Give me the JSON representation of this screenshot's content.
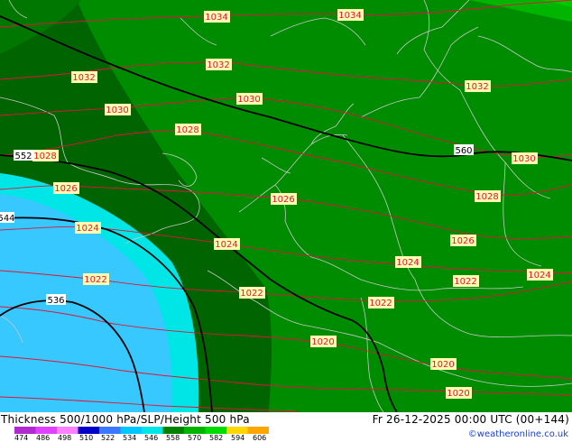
{
  "title": "Thickness 500/1000 hPa/SLP/Height 500 hPa",
  "datetime": "Fr 26-12-2025 00:00 UTC (00+144)",
  "credit": "©weatheronline.co.uk",
  "colorbar": {
    "ticks": [
      "474",
      "486",
      "498",
      "510",
      "522",
      "534",
      "546",
      "558",
      "570",
      "582",
      "594",
      "606"
    ],
    "colors": [
      "#b02ad0",
      "#e040ff",
      "#ff80ff",
      "#0000c8",
      "#3c78ff",
      "#00c8ff",
      "#00e6e6",
      "#008200",
      "#00b400",
      "#00dc00",
      "#ffd700",
      "#ffa500"
    ]
  },
  "map": {
    "colors": {
      "isobar": "#e0143c",
      "thickness_line": "#000000",
      "coast": "#c8c8c8",
      "thick_lt_546": "#006400",
      "thick_546_558": "#008c00",
      "thick_558_570": "#00b400"
    },
    "isobar_labels": [
      "1034",
      "1034",
      "1032",
      "1032",
      "1032",
      "1030",
      "1030",
      "1030",
      "1028",
      "1028",
      "1028",
      "1026",
      "1026",
      "1026",
      "1024",
      "1024",
      "1024",
      "1024",
      "1022",
      "1022",
      "1022",
      "1022",
      "1020",
      "1020",
      "1020"
    ],
    "height_labels": [
      "552",
      "560",
      "544",
      "536"
    ]
  }
}
